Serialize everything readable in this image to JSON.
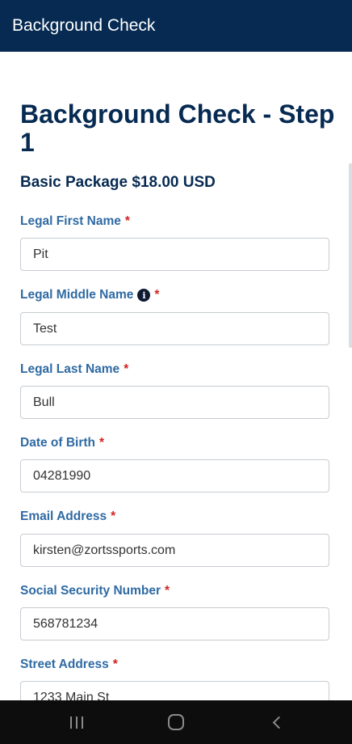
{
  "header": {
    "title": "Background Check"
  },
  "page": {
    "title": "Background Check - Step 1",
    "package": "Basic Package $18.00 USD"
  },
  "required_marker": "*",
  "info_glyph": "i",
  "fields": {
    "first_name": {
      "label": "Legal First Name",
      "value": "Pit"
    },
    "middle_name": {
      "label": "Legal Middle Name",
      "value": "Test"
    },
    "last_name": {
      "label": "Legal Last Name",
      "value": "Bull"
    },
    "dob": {
      "label": "Date of Birth",
      "value": "04281990"
    },
    "email": {
      "label": "Email Address",
      "value": "kirsten@zortssports.com"
    },
    "ssn": {
      "label": "Social Security Number",
      "value": "568781234"
    },
    "street": {
      "label": "Street Address",
      "value": "1233 Main St"
    }
  },
  "colors": {
    "header_bg": "#062a52",
    "title": "#062a52",
    "label": "#2f6aa3",
    "required": "#d62222",
    "nav_bg": "#0d0d0d"
  },
  "icons": {
    "info": "info-circle-icon",
    "recents": "recents-icon",
    "home": "home-icon",
    "back": "back-icon"
  }
}
